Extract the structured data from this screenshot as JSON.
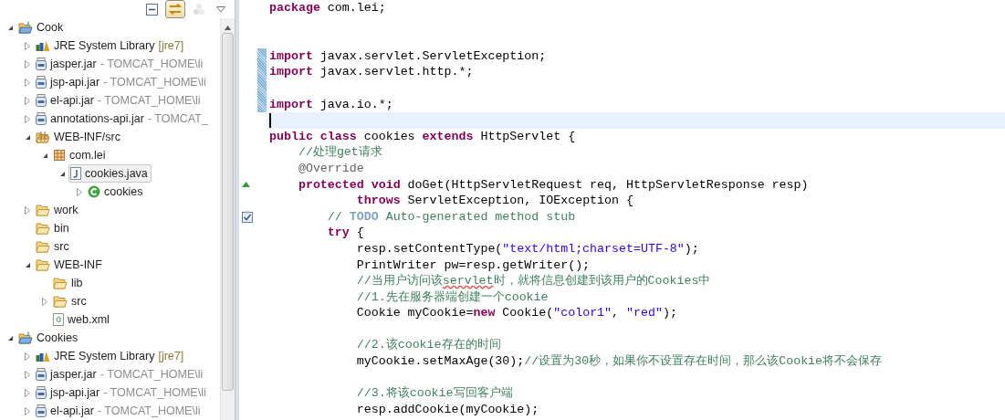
{
  "explorer": {
    "toolbar": [
      {
        "kind": "collapse",
        "selected": false,
        "disabled": false
      },
      {
        "kind": "link",
        "selected": true,
        "disabled": false
      },
      {
        "kind": "filter",
        "selected": false,
        "disabled": true
      },
      {
        "kind": "menu",
        "selected": false,
        "disabled": false
      }
    ],
    "tree": [
      {
        "kind": "project",
        "label": "Cook",
        "expanded": true,
        "selected": false,
        "children": [
          {
            "kind": "library",
            "label": "JRE System Library",
            "decoration": "[jre7]",
            "expanded": false,
            "selected": false
          },
          {
            "kind": "jar",
            "label": "jasper.jar",
            "decoration": "- TOMCAT_HOME\\li",
            "expanded": false,
            "selected": false
          },
          {
            "kind": "jar",
            "label": "jsp-api.jar",
            "decoration": "- TOMCAT_HOME\\li",
            "expanded": false,
            "selected": false
          },
          {
            "kind": "jar",
            "label": "el-api.jar",
            "decoration": "- TOMCAT_HOME\\li",
            "expanded": false,
            "selected": false
          },
          {
            "kind": "jar",
            "label": "annotations-api.jar",
            "decoration": "- TOMCAT_",
            "expanded": false,
            "selected": false
          },
          {
            "kind": "source-folder",
            "label": "WEB-INF/src",
            "expanded": true,
            "selected": false,
            "children": [
              {
                "kind": "package",
                "label": "com.lei",
                "expanded": true,
                "selected": false,
                "children": [
                  {
                    "kind": "java-file",
                    "label": "cookies.java",
                    "expanded": true,
                    "selected": true,
                    "children": [
                      {
                        "kind": "class",
                        "label": "cookies",
                        "expanded": false,
                        "selected": false
                      }
                    ]
                  }
                ]
              }
            ]
          },
          {
            "kind": "folder",
            "label": "work",
            "expanded": false,
            "selected": false
          },
          {
            "kind": "folder",
            "label": "bin",
            "selected": false
          },
          {
            "kind": "folder",
            "label": "src",
            "selected": false
          },
          {
            "kind": "folder",
            "label": "WEB-INF",
            "expanded": true,
            "selected": false,
            "children": [
              {
                "kind": "folder",
                "label": "lib",
                "selected": false
              },
              {
                "kind": "folder",
                "label": "src",
                "expanded": false,
                "selected": false
              },
              {
                "kind": "xml",
                "label": "web.xml",
                "selected": false
              }
            ]
          }
        ]
      },
      {
        "kind": "project",
        "label": "Cookies",
        "expanded": true,
        "selected": false,
        "children": [
          {
            "kind": "library",
            "label": "JRE System Library",
            "decoration": "[jre7]",
            "expanded": false,
            "selected": false
          },
          {
            "kind": "jar",
            "label": "jasper.jar",
            "decoration": "- TOMCAT_HOME\\li",
            "expanded": false,
            "selected": false
          },
          {
            "kind": "jar",
            "label": "jsp-api.jar",
            "decoration": "- TOMCAT_HOME\\li",
            "expanded": false,
            "selected": false
          },
          {
            "kind": "jar",
            "label": "el-api.jar",
            "decoration": "- TOMCAT_HOME\\li",
            "expanded": false,
            "selected": false
          }
        ]
      }
    ]
  },
  "editor": {
    "lines": [
      {
        "kind": "code",
        "tokens": [
          {
            "kind": "keyword",
            "text": "package"
          },
          {
            "kind": "plain",
            "text": " com.lei;"
          }
        ]
      },
      {
        "kind": "blank"
      },
      {
        "kind": "blank"
      },
      {
        "kind": "code",
        "marker": {
          "kind": "change"
        },
        "tokens": [
          {
            "kind": "keyword",
            "text": "import"
          },
          {
            "kind": "plain",
            "text": " javax.servlet.ServletException;"
          }
        ]
      },
      {
        "kind": "code",
        "marker": {
          "kind": "change"
        },
        "tokens": [
          {
            "kind": "keyword",
            "text": "import"
          },
          {
            "kind": "plain",
            "text": " javax.servlet.http.*;"
          }
        ]
      },
      {
        "kind": "blank",
        "marker": {
          "kind": "change"
        }
      },
      {
        "kind": "code",
        "marker": {
          "kind": "change"
        },
        "tokens": [
          {
            "kind": "keyword",
            "text": "import"
          },
          {
            "kind": "plain",
            "text": " java.io.*;"
          }
        ]
      },
      {
        "kind": "blank",
        "current": true
      },
      {
        "kind": "code",
        "tokens": [
          {
            "kind": "keyword",
            "text": "public class"
          },
          {
            "kind": "plain",
            "text": " cookies "
          },
          {
            "kind": "keyword",
            "text": "extends"
          },
          {
            "kind": "plain",
            "text": " HttpServlet {"
          }
        ]
      },
      {
        "kind": "code",
        "tokens": [
          {
            "kind": "comment",
            "text": "    //处理get请求"
          }
        ]
      },
      {
        "kind": "code",
        "tokens": [
          {
            "kind": "annotation",
            "text": "    @Override"
          }
        ]
      },
      {
        "kind": "code",
        "marker": {
          "kind": "override"
        },
        "tokens": [
          {
            "kind": "keyword",
            "text": "    protected void"
          },
          {
            "kind": "plain",
            "text": " doGet(HttpServletRequest req, HttpServletResponse resp)"
          }
        ]
      },
      {
        "kind": "code",
        "tokens": [
          {
            "kind": "keyword",
            "text": "            throws"
          },
          {
            "kind": "plain",
            "text": " ServletException, IOException {"
          }
        ]
      },
      {
        "kind": "code",
        "marker": {
          "kind": "task"
        },
        "tokens": [
          {
            "kind": "comment",
            "text": "        // "
          },
          {
            "kind": "task-tag",
            "text": "TODO"
          },
          {
            "kind": "comment",
            "text": " Auto-generated method stub"
          }
        ]
      },
      {
        "kind": "code",
        "tokens": [
          {
            "kind": "keyword",
            "text": "        try"
          },
          {
            "kind": "plain",
            "text": " {"
          }
        ]
      },
      {
        "kind": "code",
        "tokens": [
          {
            "kind": "plain",
            "text": "            resp.setContentType("
          },
          {
            "kind": "string",
            "text": "\"text/html;charset=UTF-8\""
          },
          {
            "kind": "plain",
            "text": ");"
          }
        ]
      },
      {
        "kind": "code",
        "tokens": [
          {
            "kind": "plain",
            "text": "            PrintWriter pw=resp.getWriter();"
          }
        ]
      },
      {
        "kind": "code",
        "tokens": [
          {
            "kind": "comment",
            "text": "            //当用户访问该"
          },
          {
            "kind": "misspelled-comment",
            "text": "servlet"
          },
          {
            "kind": "comment",
            "text": "时，就将信息创建到该用户的Cookies中"
          }
        ]
      },
      {
        "kind": "code",
        "tokens": [
          {
            "kind": "comment",
            "text": "            //1.先在服务器端创建一个cookie"
          }
        ]
      },
      {
        "kind": "code",
        "tokens": [
          {
            "kind": "plain",
            "text": "            Cookie myCookie="
          },
          {
            "kind": "keyword",
            "text": "new"
          },
          {
            "kind": "plain",
            "text": " Cookie("
          },
          {
            "kind": "string",
            "text": "\"color1\""
          },
          {
            "kind": "plain",
            "text": ", "
          },
          {
            "kind": "string",
            "text": "\"red\""
          },
          {
            "kind": "plain",
            "text": ");"
          }
        ]
      },
      {
        "kind": "blank"
      },
      {
        "kind": "code",
        "tokens": [
          {
            "kind": "comment",
            "text": "            //2.该cookie存在的时间"
          }
        ]
      },
      {
        "kind": "code",
        "tokens": [
          {
            "kind": "plain",
            "text": "            myCookie.setMaxAge(30);"
          },
          {
            "kind": "comment",
            "text": "//设置为30秒，如果你不设置存在时间，那么该Cookie将不会保存"
          }
        ]
      },
      {
        "kind": "blank"
      },
      {
        "kind": "code",
        "tokens": [
          {
            "kind": "comment",
            "text": "            //3.将该cookie写回客户端"
          }
        ]
      },
      {
        "kind": "code",
        "tokens": [
          {
            "kind": "plain",
            "text": "            resp.addCookie(myCookie);"
          }
        ]
      }
    ]
  }
}
